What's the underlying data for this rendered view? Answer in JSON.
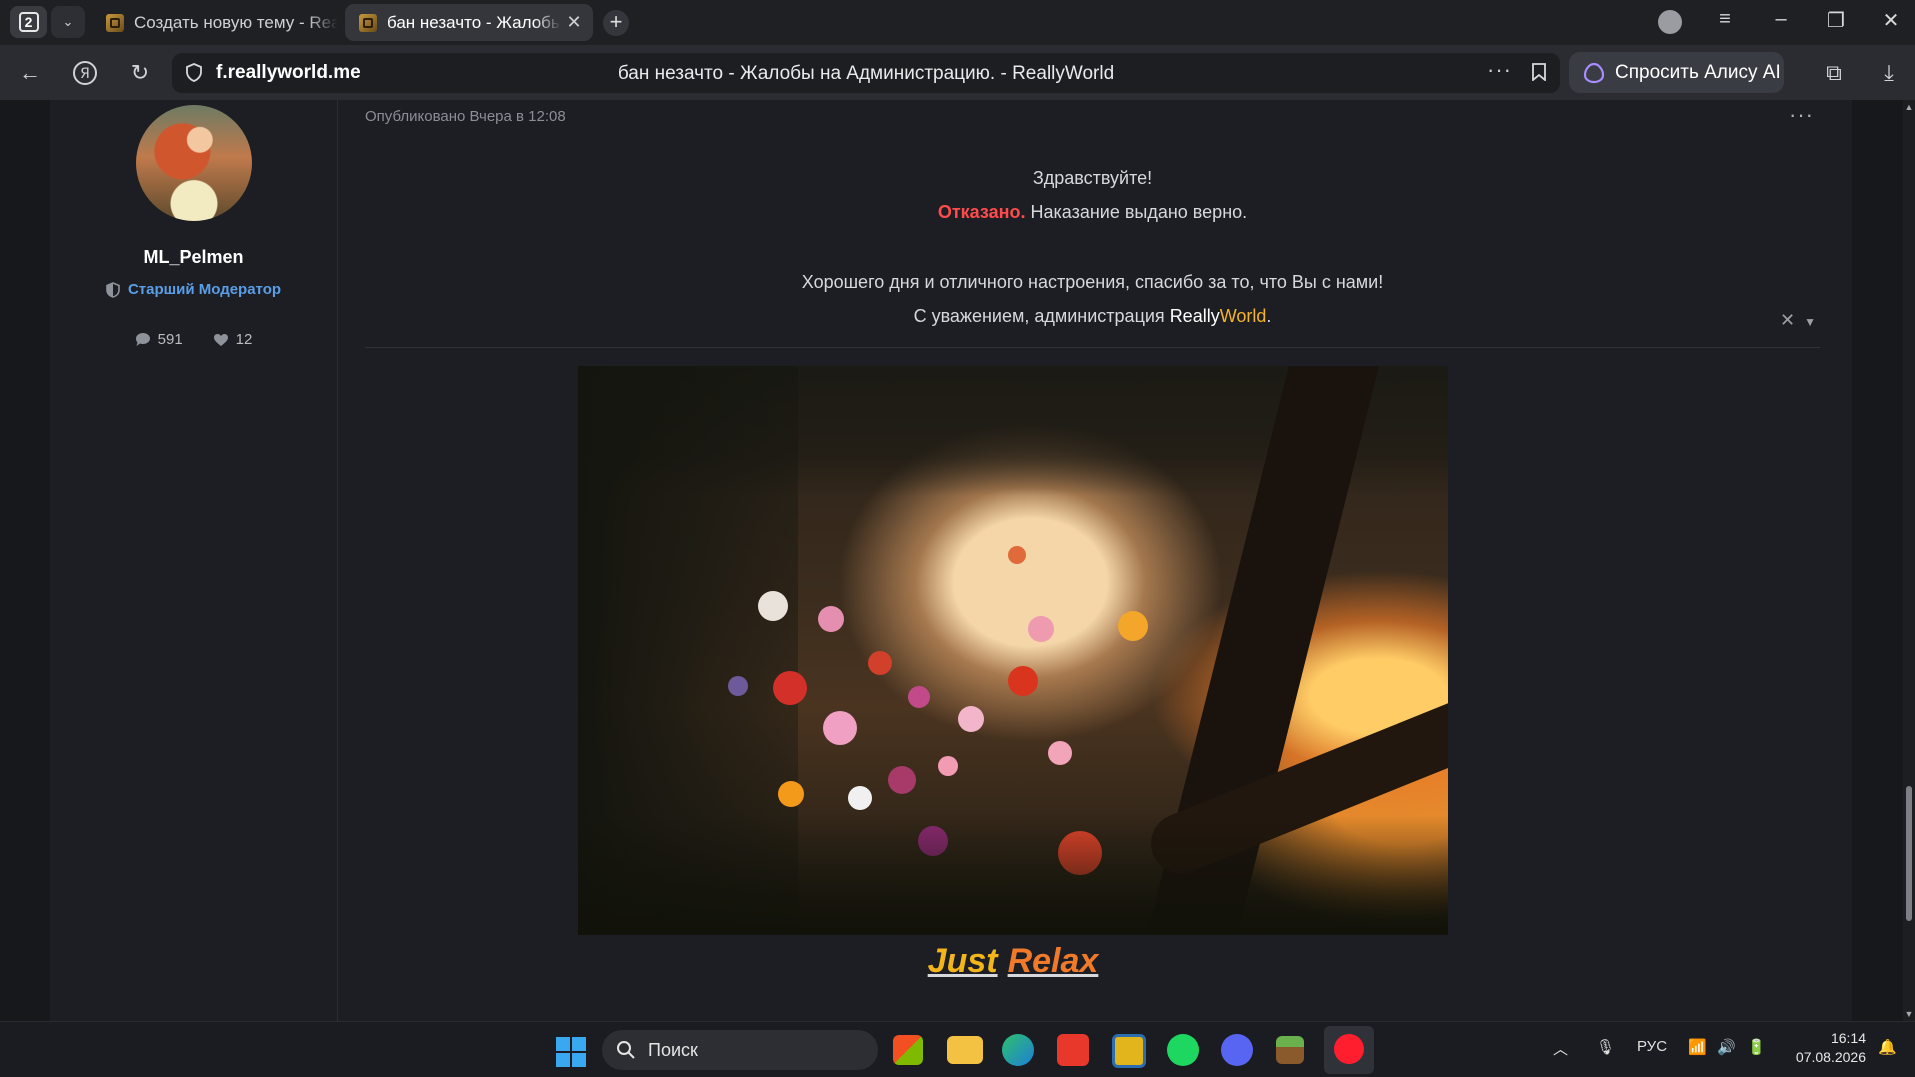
{
  "browser": {
    "tab_count": "2",
    "tabs": [
      {
        "title": "Создать новую тему - ReallyWorld",
        "active": false
      },
      {
        "title": "бан незачто - Жалобы на Администрацию. - ReallyWorld",
        "active": true
      }
    ],
    "address": {
      "domain": "f.reallyworld.me",
      "page_title": "бан незачто - Жалобы на Администрацию. - ReallyWorld"
    },
    "alice_button": "Спросить Алису AI"
  },
  "post": {
    "author": {
      "username": "ML_Pelmen",
      "role": "Старший Модератор",
      "messages": "591",
      "likes": "12"
    },
    "published": "Опубликовано Вчера в 12:08",
    "body": {
      "greeting": "Здравствуйте!",
      "verdict_label": "Отказано.",
      "verdict_text": " Наказание выдано верно.",
      "wish": "Хорошего дня и отличного настроения, спасибо за то, что Вы с нами!",
      "sign_prefix": "С уважением, администрация ",
      "brand_really": "Really",
      "brand_world": "World",
      "sign_suffix": "."
    },
    "signature": {
      "caption_word1": "Just",
      "caption_word2": "Relax"
    }
  },
  "taskbar": {
    "search_placeholder": "Поиск",
    "language": "РУС",
    "time": "16:14",
    "date": "07.08.2026"
  },
  "colors": {
    "denied": "#ff4b4b",
    "brand_world": "#f5b32a",
    "role": "#5a9ee8"
  }
}
